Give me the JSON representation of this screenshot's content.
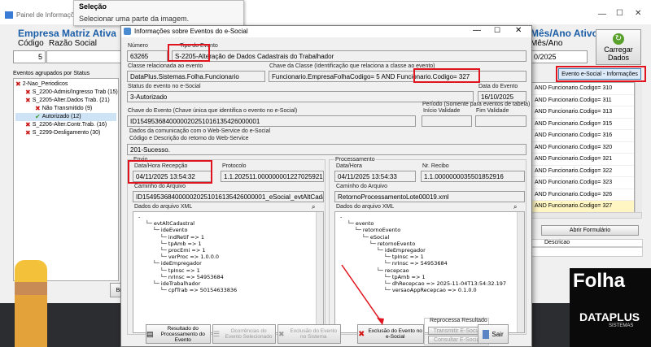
{
  "bg_window": {
    "title": "Painel de Informações",
    "company_label": "Empresa Matriz Ativa",
    "col_codigo": "Código",
    "col_razao": "Razão Social",
    "codigo_value": "5",
    "month_label": "Mês/Ano Ativo",
    "month_sub": "Mês/Ano",
    "month_value": "0/2025",
    "carregar_label": "Carregar Dados",
    "evento_info_button": "Evento e-Social - Informações",
    "abrir_formulario": "Abrir Formulário",
    "descricao_col": "Descricao",
    "events_status_label": "Eventos agrupados por Status",
    "list_rows": [
      "AND Funcionario.Codigo= 310",
      "AND Funcionario.Codigo= 311",
      "AND Funcionario.Codigo= 313",
      "AND Funcionario.Codigo= 315",
      "AND Funcionario.Codigo= 316",
      "AND Funcionario.Codigo= 320",
      "AND Funcionario.Codigo= 321",
      "AND Funcionario.Codigo= 322",
      "AND Funcionario.Codigo= 323",
      "AND Funcionario.Codigo= 326",
      "AND Funcionario.Codigo= 327"
    ],
    "tree": [
      {
        "label": "2-Nao_Periodicos",
        "level": 0,
        "icon": "x"
      },
      {
        "label": "S_2200-Admis/Ingresso Trab (15)",
        "level": 1,
        "icon": "x"
      },
      {
        "label": "S_2205-Alter.Dados Trab. (21)",
        "level": 1,
        "icon": "x"
      },
      {
        "label": "Não Transmitido (9)",
        "level": 2,
        "icon": "x"
      },
      {
        "label": "Autorizado (12)",
        "level": 2,
        "icon": "check"
      },
      {
        "label": "S_2206-Alter.Contr.Trab. (16)",
        "level": 1,
        "icon": "x"
      },
      {
        "label": "S_2299-Desligamento (30)",
        "level": 1,
        "icon": "x"
      }
    ],
    "brand_fragment": "Folha",
    "brand_logo": "DATAPLUS",
    "brand_logo_sub": "SISTEMAS"
  },
  "tooltip": {
    "title": "Seleção",
    "text": "Selecionar uma parte da imagem."
  },
  "dialog": {
    "title": "Informações sobre Eventos do e-Social",
    "numero_label": "Número",
    "numero_value": "63265",
    "tipo_label": "Tipo do Evento",
    "tipo_value": "S-2205-Alteração de Dados Cadastrais do Trabalhador",
    "classe_label": "Classe relacionada ao evento",
    "classe_value": "DataPlus.Sistemas.Folha.Funcionario",
    "chave_classe_label": "Chave da Classe (Identificação que relaciona a classe ao evento)",
    "chave_classe_value": "Funcionario.EmpresaFolhaCodigo= 5  AND Funcionario.Codigo= 327",
    "status_label": "Status do evento no e-Social",
    "status_value": "3-Autorizado",
    "data_evento_label": "Data do Evento",
    "data_evento_value": "16/10/2025",
    "chave_evento_label": "Chave do Evento (Chave única que identifica o evento no e-Social)",
    "chave_evento_value": "ID1549536840000020251016135426000001",
    "periodo_label": "Período (Somente para eventos de tabela)",
    "inicio_label": "Início Validade",
    "fim_label": "Fim Validade",
    "comunicacao_label": "Dados da comunicação com o Web-Service do e-Social",
    "codigo_retorno_label": "Código e Descrição do retorno do Web-Service",
    "codigo_retorno_value": "201-Sucesso.",
    "envio_label": "Envio",
    "envio_data_label": "Data/Hora Recepção",
    "envio_data_value": "04/11/2025 13:54:32",
    "protocolo_label": "Protocolo",
    "protocolo_value": "1.1.202511.0000000012270259216",
    "processamento_label": "Processamento",
    "proc_data_label": "Data/Hora",
    "proc_data_value": "04/11/2025 13:54:33",
    "nr_recibo_label": "Nr. Recibo",
    "nr_recibo_value": "1.1.0000000035501852916",
    "caminho_label_left": "Caminho do Arquivo",
    "caminho_value_left": "ID1549536840000020251016135426000001_eSocial_evtAltCadast",
    "caminho_label_right": "Caminho do Arquivo",
    "caminho_value_right": "RetornoProcessamentoLote00019.xml",
    "xml_label_left": "Dados do arquivo XML",
    "xml_label_right": "Dados do arquivo XML",
    "xml_left": [
      {
        "t": "-",
        "d": 0
      },
      {
        "t": "evtAltCadastral",
        "d": 1
      },
      {
        "t": "ideEvento",
        "d": 2
      },
      {
        "t": "indRetif => 1",
        "d": 3
      },
      {
        "t": "tpAmb => 1",
        "d": 3
      },
      {
        "t": "procEmi => 1",
        "d": 3
      },
      {
        "t": "verProc => 1.0.0.0",
        "d": 3
      },
      {
        "t": "ideEmpregador",
        "d": 2
      },
      {
        "t": "tpInsc => 1",
        "d": 3
      },
      {
        "t": "nrInsc => 54953684",
        "d": 3
      },
      {
        "t": "ideTrabalhador",
        "d": 2
      },
      {
        "t": "cpfTrab => 50154633836",
        "d": 3
      }
    ],
    "xml_right": [
      {
        "t": "-",
        "d": 0
      },
      {
        "t": "evento",
        "d": 1
      },
      {
        "t": "retornoEvento",
        "d": 2
      },
      {
        "t": "eSocial",
        "d": 3
      },
      {
        "t": "retornoEvento",
        "d": 4
      },
      {
        "t": "ideEmpregador",
        "d": 5
      },
      {
        "t": "tpInsc => 1",
        "d": 6
      },
      {
        "t": "nrInsc => 54953684",
        "d": 6
      },
      {
        "t": "recepcao",
        "d": 5
      },
      {
        "t": "tpAmb => 1",
        "d": 6
      },
      {
        "t": "dhRecepcao => 2025-11-04T13:54:32.197",
        "d": 6
      },
      {
        "t": "versaoAppRecepcao => 0.1.0.0",
        "d": 6
      }
    ],
    "btn_resultado": "Resultado do Processamento do Evento",
    "btn_ocorrencias": "Ocorrências do Evento Selecionado",
    "btn_exclusao_sistema": "Exclusão do Evento no Sistema",
    "btn_exclusao_esocial": "Exclusão do Evento no e-Social",
    "reprocessa_label": "Reprocessa Resultado",
    "btn_transmitir": "Transmitir E-Social",
    "btn_consultar": "Consultar E-Social",
    "btn_sair": "Sair"
  },
  "colors": {
    "accent_red": "#e0141e",
    "title_blue": "#1c5fa8",
    "dialog_bg": "#f0f0f0"
  }
}
